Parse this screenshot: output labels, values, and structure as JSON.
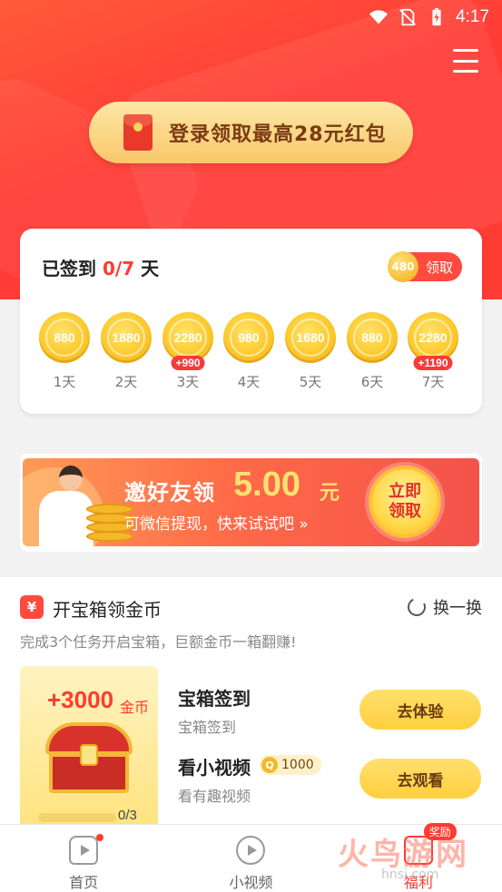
{
  "status_bar": {
    "time": "4:17"
  },
  "header": {
    "login_banner": "登录领取最高28元红包"
  },
  "signin": {
    "prefix": "已签到 ",
    "count": "0/7",
    "suffix": " 天",
    "claim_coin": "480",
    "claim_label": "领取",
    "days": [
      {
        "coins": "880",
        "label": "1天",
        "bonus": ""
      },
      {
        "coins": "1880",
        "label": "2天",
        "bonus": ""
      },
      {
        "coins": "2280",
        "label": "3天",
        "bonus": "+990"
      },
      {
        "coins": "980",
        "label": "4天",
        "bonus": ""
      },
      {
        "coins": "1680",
        "label": "5天",
        "bonus": ""
      },
      {
        "coins": "880",
        "label": "6天",
        "bonus": ""
      },
      {
        "coins": "2280",
        "label": "7天",
        "bonus": "+1190"
      }
    ]
  },
  "invite": {
    "title": "邀好友领",
    "amount": "5.00",
    "unit": "元",
    "subtitle": "可微信提现，快来试试吧 »",
    "cta": "立即领取"
  },
  "treasure": {
    "icon_text": "¥",
    "title": "开宝箱领金币",
    "refresh_label": "换一换",
    "subtitle": "完成3个任务开启宝箱，巨额金币一箱翻赚!",
    "reward": "+3000",
    "reward_unit": "金币",
    "progress": "0/3",
    "progress_fraction": 0,
    "tasks": [
      {
        "title": "宝箱签到",
        "desc": "宝箱签到",
        "button": "去体验"
      },
      {
        "title": "看小视频",
        "desc": "看有趣视频",
        "button": "去观看",
        "badge_icon": "Q",
        "badge_value": "1000"
      }
    ]
  },
  "bottom_nav": {
    "items": [
      {
        "label": "首页"
      },
      {
        "label": "小视频"
      },
      {
        "label": "福利",
        "badge": "奖励"
      }
    ]
  },
  "watermark": {
    "text": "火鸟游网",
    "sub": "hnsj.com"
  }
}
